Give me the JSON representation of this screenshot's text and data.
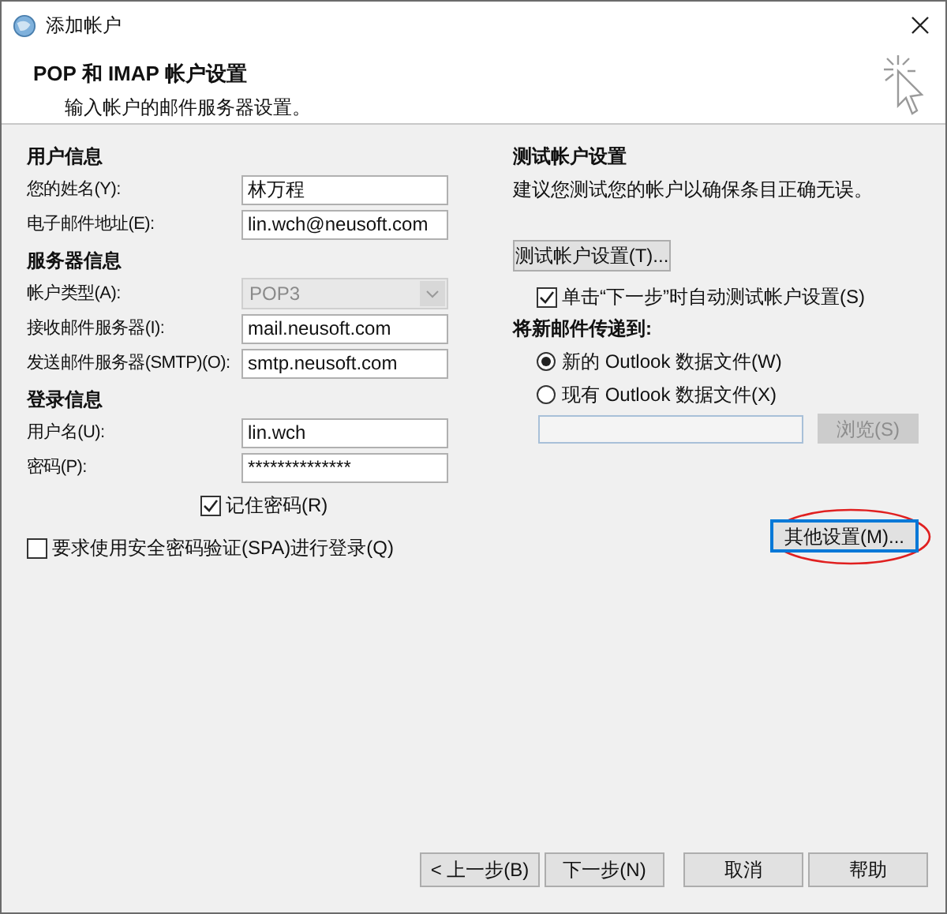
{
  "window": {
    "title": "添加帐户"
  },
  "header": {
    "title": "POP 和 IMAP 帐户设置",
    "subtitle": "输入帐户的邮件服务器设置。"
  },
  "left_sections": [
    {
      "heading": "用户信息",
      "fields": [
        {
          "kind": "text",
          "label": "您的姓名(Y):",
          "value": "林万程"
        },
        {
          "kind": "text",
          "label": "电子邮件地址(E):",
          "value": "lin.wch@neusoft.com"
        }
      ]
    },
    {
      "heading": "服务器信息",
      "fields": [
        {
          "kind": "select",
          "label": "帐户类型(A):",
          "value": "POP3",
          "disabled": true
        },
        {
          "kind": "text",
          "label": "接收邮件服务器(I):",
          "value": "mail.neusoft.com"
        },
        {
          "kind": "text",
          "label": "发送邮件服务器(SMTP)(O):",
          "value": "smtp.neusoft.com"
        }
      ]
    },
    {
      "heading": "登录信息",
      "fields": [
        {
          "kind": "text",
          "label": "用户名(U):",
          "value": "lin.wch"
        },
        {
          "kind": "password",
          "label": "密码(P):",
          "value": "**************"
        }
      ]
    }
  ],
  "remember_password": {
    "label": "记住密码(R)",
    "checked": true
  },
  "spa": {
    "label": "要求使用安全密码验证(SPA)进行登录(Q)",
    "checked": false
  },
  "test": {
    "heading": "测试帐户设置",
    "description": "建议您测试您的帐户以确保条目正确无误。",
    "button": "测试帐户设置(T)...",
    "auto_test": {
      "label": "单击“下一步”时自动测试帐户设置(S)",
      "checked": true
    }
  },
  "delivery": {
    "heading": "将新邮件传递到:",
    "options": [
      {
        "label": "新的 Outlook 数据文件(W)",
        "selected": true
      },
      {
        "label": "现有 Outlook 数据文件(X)",
        "selected": false
      }
    ],
    "browse": {
      "label": "浏览(S)",
      "disabled": true
    }
  },
  "more_settings": {
    "label": "其他设置(M)...",
    "highlighted": true
  },
  "footer_buttons": [
    {
      "label": "< 上一步(B)"
    },
    {
      "label": "下一步(N)"
    },
    {
      "label": "取消"
    },
    {
      "label": "帮助"
    }
  ]
}
